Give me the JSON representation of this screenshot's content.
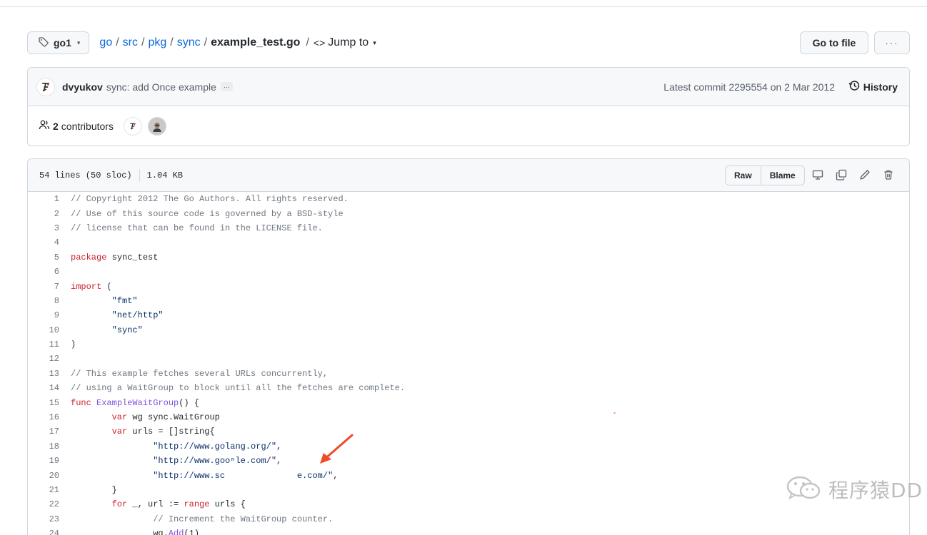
{
  "branch": {
    "name": "go1"
  },
  "breadcrumb": {
    "segments": [
      "go",
      "src",
      "pkg",
      "sync"
    ],
    "file": "example_test.go",
    "jump_label": "Jump to"
  },
  "actions": {
    "goto_file": "Go to file",
    "more": "···"
  },
  "commit": {
    "author": "dvyukov",
    "message": "sync: add Once example",
    "ellipsis": "…",
    "latest": "Latest commit 2295554 on 2 Mar 2012",
    "history": "History"
  },
  "contributors": {
    "count": "2",
    "label": "contributors"
  },
  "file": {
    "lines_info": "54 lines (50 sloc)",
    "size": "1.04 KB",
    "raw": "Raw",
    "blame": "Blame"
  },
  "code_lines": [
    {
      "n": "1",
      "t": "// Copyright 2012 The Go Authors. All rights reserved."
    },
    {
      "n": "2",
      "t": "// Use of this source code is governed by a BSD-style"
    },
    {
      "n": "3",
      "t": "// license that can be found in the LICENSE file."
    },
    {
      "n": "4",
      "t": ""
    },
    {
      "n": "5",
      "t": "package sync_test"
    },
    {
      "n": "6",
      "t": ""
    },
    {
      "n": "7",
      "t": "import ("
    },
    {
      "n": "8",
      "t": "\t\"fmt\""
    },
    {
      "n": "9",
      "t": "\t\"net/http\""
    },
    {
      "n": "10",
      "t": "\t\"sync\""
    },
    {
      "n": "11",
      "t": ")"
    },
    {
      "n": "12",
      "t": ""
    },
    {
      "n": "13",
      "t": "// This example fetches several URLs concurrently,"
    },
    {
      "n": "14",
      "t": "// using a WaitGroup to block until all the fetches are complete."
    },
    {
      "n": "15",
      "t": "func ExampleWaitGroup() {"
    },
    {
      "n": "16",
      "t": "\tvar wg sync.WaitGroup"
    },
    {
      "n": "17",
      "t": "\tvar urls = []string{"
    },
    {
      "n": "18",
      "t": "\t\t\"http://www.golang.org/\","
    },
    {
      "n": "19",
      "t": "\t\t\"http://www.gooⁿle.com/\","
    },
    {
      "n": "20",
      "t": "\t\t\"http://www.sc              e.com/\","
    },
    {
      "n": "21",
      "t": "\t}"
    },
    {
      "n": "22",
      "t": "\tfor _, url := range urls {"
    },
    {
      "n": "23",
      "t": "\t\t// Increment the WaitGroup counter."
    },
    {
      "n": "24",
      "t": "\t\twg.Add(1)"
    }
  ],
  "watermark": {
    "text": "程序猿DD",
    "icon": "wechat-icon"
  },
  "colors": {
    "link": "#0969da",
    "keyword": "#cf222e",
    "string": "#0a3069",
    "function": "#8250df",
    "comment": "#6e7781",
    "arrow": "#f04a2a"
  }
}
